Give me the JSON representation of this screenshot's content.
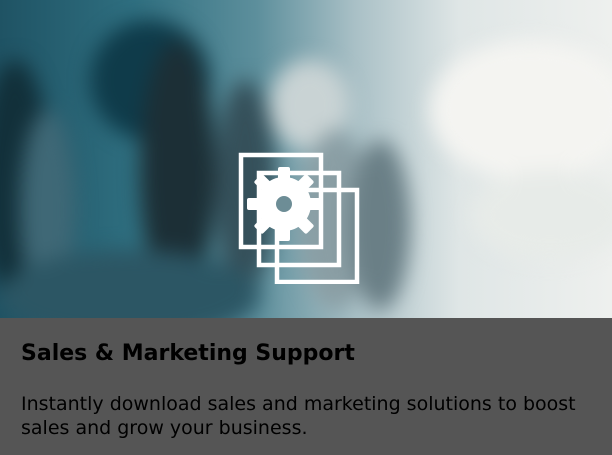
{
  "card": {
    "title": "Sales & Marketing Support",
    "description": "Instantly download sales and marketing solutions to boost sales and grow your business."
  },
  "hero": {
    "icon": "documents-gear-icon",
    "background": "blurred-office-people-photo"
  },
  "colors": {
    "caption_background": "#555555",
    "caption_text": "#ffffff",
    "icon_stroke": "#ffffff"
  }
}
